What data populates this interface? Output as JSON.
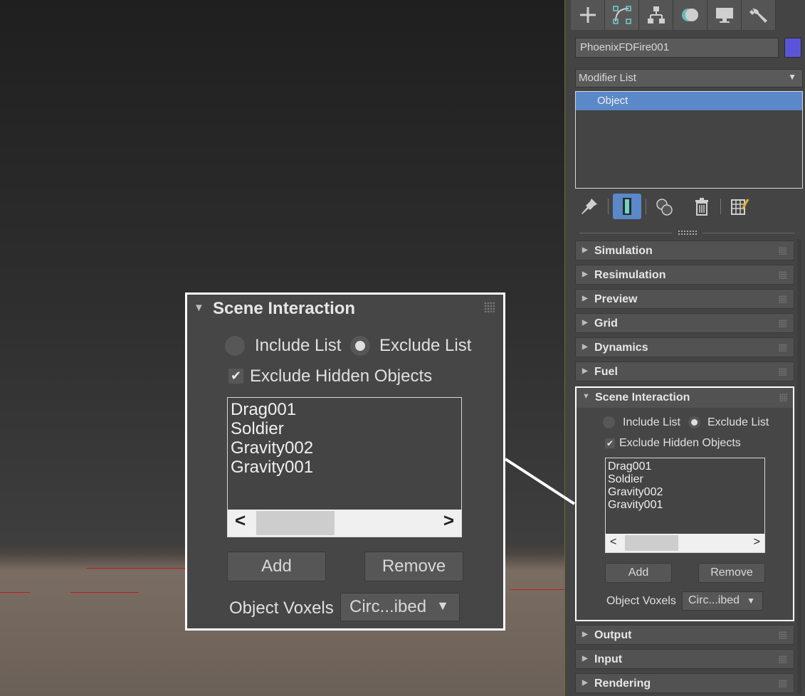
{
  "object_name": "PhoenixFDFire001",
  "object_color": "#5a55d8",
  "modifier_list": {
    "label": "Modifier List"
  },
  "stack": {
    "items": [
      "Object"
    ]
  },
  "command_tabs": [
    "create-icon",
    "modify-icon",
    "hierarchy-icon",
    "motion-icon",
    "display-icon",
    "utilities-icon"
  ],
  "rollouts_top": [
    "Simulation",
    "Resimulation",
    "Preview",
    "Grid",
    "Dynamics",
    "Fuel"
  ],
  "rollouts_bottom": [
    "Output",
    "Input",
    "Rendering"
  ],
  "scene_interaction": {
    "title": "Scene Interaction",
    "include_label": "Include List",
    "exclude_label": "Exclude List",
    "selected_mode": "exclude",
    "exclude_hidden_label": "Exclude Hidden Objects",
    "exclude_hidden_checked": true,
    "objects": [
      "Drag001",
      "Soldier",
      "Gravity002",
      "Gravity001"
    ],
    "add_label": "Add",
    "remove_label": "Remove",
    "voxels_label": "Object Voxels",
    "voxels_value": "Circ...ibed"
  }
}
